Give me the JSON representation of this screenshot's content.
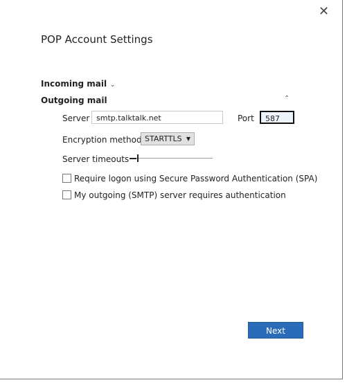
{
  "dialog": {
    "title": "POP Account Settings",
    "close_icon": "close-icon"
  },
  "incoming": {
    "label": "Incoming mail",
    "icon": "chevron-down-icon"
  },
  "outgoing": {
    "label": "Outgoing mail",
    "icon": "chevron-up-icon",
    "server_label": "Server",
    "server_value": "smtp.talktalk.net",
    "port_label": "Port",
    "port_value": "587",
    "encryption_label": "Encryption method",
    "encryption_value": "STARTTLS",
    "timeouts_label": "Server timeouts",
    "timeouts_level": 0.03,
    "spa_label": "Require logon using Secure Password Authentication (SPA)",
    "spa_checked": false,
    "auth_label": "My outgoing (SMTP) server requires authentication",
    "auth_checked": false
  },
  "footer": {
    "next_label": "Next"
  },
  "colors": {
    "accent": "#2b6cb8"
  }
}
